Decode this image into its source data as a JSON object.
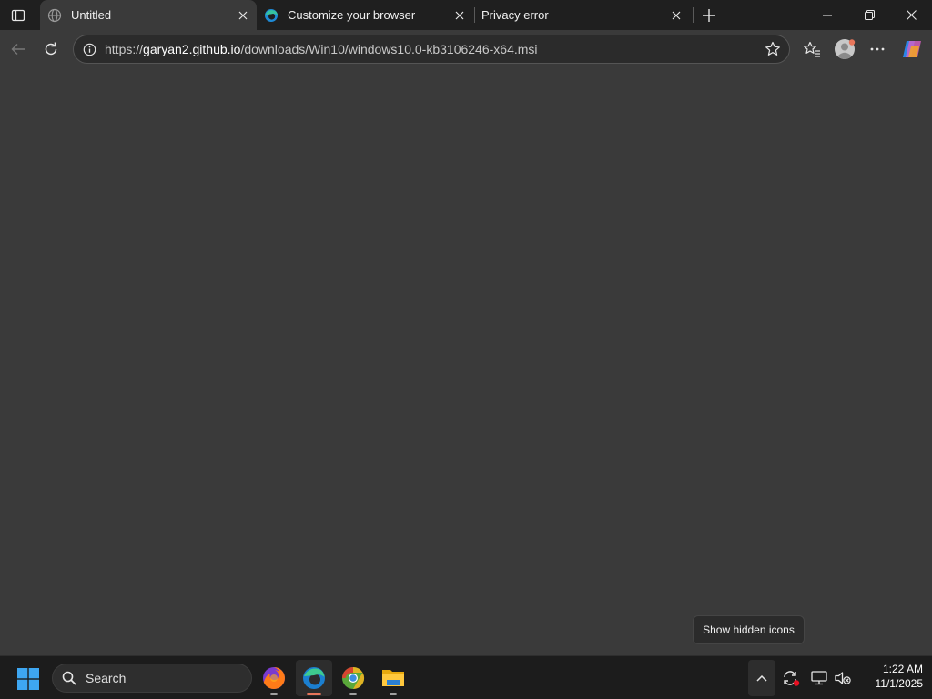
{
  "browser": {
    "tabs": [
      {
        "title": "Untitled",
        "favicon": "globe-icon",
        "active": true
      },
      {
        "title": "Customize your browser",
        "favicon": "edge-icon",
        "active": false
      },
      {
        "title": "Privacy error",
        "favicon": "none",
        "active": false
      }
    ],
    "address_bar": {
      "url_scheme": "https://",
      "url_host": "garyan2.github.io",
      "url_path": "/downloads/Win10/windows10.0-kb3106246-x64.msi"
    }
  },
  "tooltip": {
    "text": "Show hidden icons"
  },
  "taskbar": {
    "search_label": "Search",
    "apps": [
      "firefox-icon",
      "edge-icon",
      "chrome-icon",
      "file-explorer-icon"
    ],
    "clock_time": "1:22 AM",
    "clock_date": "11/1/2025"
  },
  "colors": {
    "page_bg": "#3a3a3a",
    "titlebar_bg": "#1f1f1f",
    "taskbar_bg": "#1c1c1c",
    "accent": "#e8765b"
  }
}
